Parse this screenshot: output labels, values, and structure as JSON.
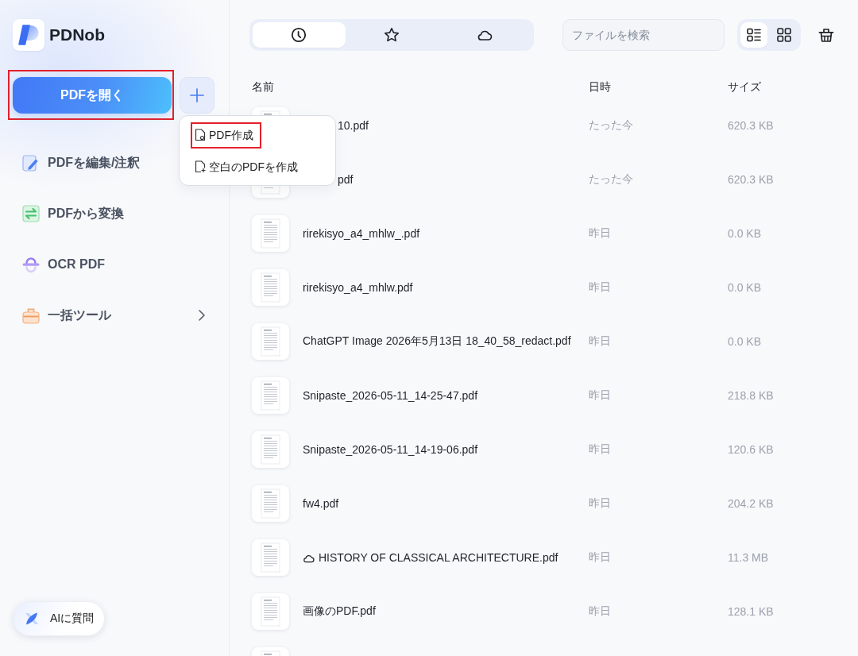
{
  "app": {
    "name": "PDNob"
  },
  "sidebar": {
    "open_button": {
      "label": "PDFを開く",
      "highlighted": true
    },
    "nav": [
      {
        "kind": "edit",
        "label": "PDFを編集/注釈",
        "has_submenu": false
      },
      {
        "kind": "convert",
        "label": "PDFから変換",
        "has_submenu": false
      },
      {
        "kind": "ocr",
        "label": "OCR PDF",
        "has_submenu": false
      },
      {
        "kind": "batch",
        "label": "一括ツール",
        "has_submenu": true
      }
    ],
    "ai_button": {
      "label": "AIに質問"
    }
  },
  "create_menu": {
    "items": [
      {
        "kind": "create",
        "label": "PDF作成",
        "highlighted": true
      },
      {
        "kind": "blank",
        "label": "空白のPDFを作成",
        "highlighted": false
      }
    ]
  },
  "toolbar": {
    "tabs": [
      {
        "kind": "clock",
        "selected": true
      },
      {
        "kind": "star",
        "selected": false
      },
      {
        "kind": "cloud",
        "selected": false
      }
    ],
    "search": {
      "placeholder": "ファイルを検索"
    },
    "views": [
      {
        "kind": "list",
        "selected": true
      },
      {
        "kind": "grid",
        "selected": false
      }
    ]
  },
  "table": {
    "columns": [
      "名前",
      "日時",
      "サイズ"
    ],
    "rows": [
      {
        "name": "10.pdf",
        "date": "たった今",
        "size": "620.3 KB",
        "cloud": false
      },
      {
        "name": "pdf",
        "date": "たった今",
        "size": "620.3 KB",
        "cloud": false
      },
      {
        "name": "rirekisyo_a4_mhlw_.pdf",
        "date": "昨日",
        "size": "0.0 KB",
        "cloud": false
      },
      {
        "name": "rirekisyo_a4_mhlw.pdf",
        "date": "昨日",
        "size": "0.0 KB",
        "cloud": false
      },
      {
        "name": "ChatGPT Image 2026年5月13日 18_40_58_redact.pdf",
        "date": "昨日",
        "size": "0.0 KB",
        "cloud": false
      },
      {
        "name": "Snipaste_2026-05-11_14-25-47.pdf",
        "date": "昨日",
        "size": "218.8 KB",
        "cloud": false
      },
      {
        "name": "Snipaste_2026-05-11_14-19-06.pdf",
        "date": "昨日",
        "size": "120.6 KB",
        "cloud": false
      },
      {
        "name": "fw4.pdf",
        "date": "昨日",
        "size": "204.2 KB",
        "cloud": false
      },
      {
        "name": "HISTORY OF CLASSICAL ARCHITECTURE.pdf",
        "date": "昨日",
        "size": "11.3 MB",
        "cloud": true
      },
      {
        "name": "画像のPDF.pdf",
        "date": "昨日",
        "size": "128.1 KB",
        "cloud": false
      },
      {
        "cloud": false
      }
    ]
  }
}
